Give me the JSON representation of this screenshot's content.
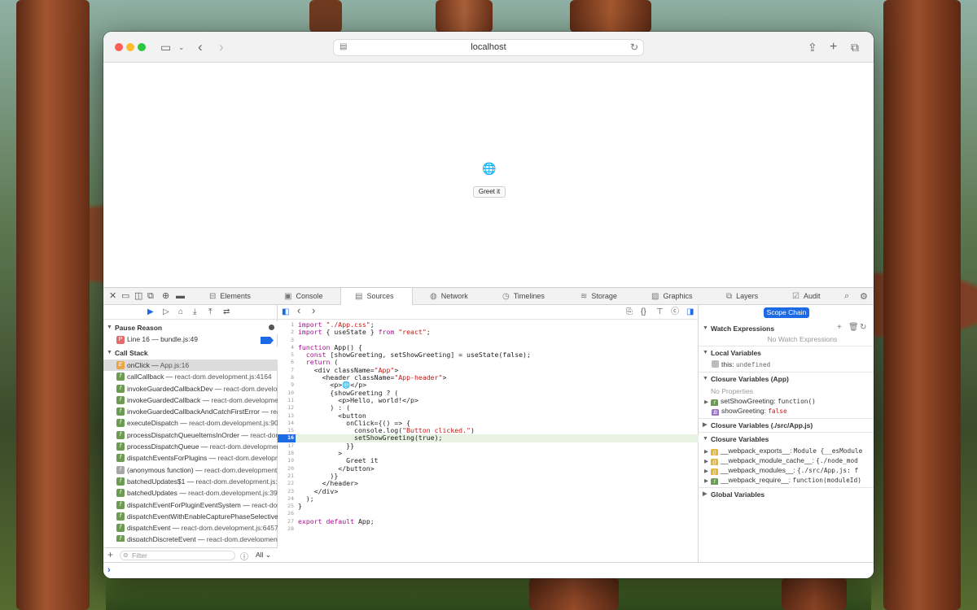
{
  "window": {
    "url": "localhost"
  },
  "page": {
    "greet_button": "Greet it"
  },
  "devtools": {
    "tabs": [
      {
        "label": "Elements",
        "icon": "elements-icon"
      },
      {
        "label": "Console",
        "icon": "console-icon"
      },
      {
        "label": "Sources",
        "icon": "sources-icon",
        "active": true
      },
      {
        "label": "Network",
        "icon": "network-icon"
      },
      {
        "label": "Timelines",
        "icon": "timelines-icon"
      },
      {
        "label": "Storage",
        "icon": "storage-icon"
      },
      {
        "label": "Graphics",
        "icon": "graphics-icon"
      },
      {
        "label": "Layers",
        "icon": "layers-icon"
      },
      {
        "label": "Audit",
        "icon": "audit-icon"
      }
    ],
    "pause_reason": {
      "header": "Pause Reason",
      "badge": "P",
      "text": "Line 16 — bundle.js:49"
    },
    "call_stack": {
      "header": "Call Stack",
      "frames": [
        {
          "fn": "onClick",
          "loc": "App.js:16",
          "badge": "E"
        },
        {
          "fn": "callCallback",
          "loc": "react-dom.development.js:4164",
          "badge": "f"
        },
        {
          "fn": "invokeGuardedCallbackDev",
          "loc": "react-dom.development.js",
          "badge": "f"
        },
        {
          "fn": "invokeGuardedCallback",
          "loc": "react-dom.development.js",
          "badge": "f"
        },
        {
          "fn": "invokeGuardedCallbackAndCatchFirstError",
          "loc": "react-dom.development.js",
          "badge": "f"
        },
        {
          "fn": "executeDispatch",
          "loc": "react-dom.development.js:9041",
          "badge": "f"
        },
        {
          "fn": "processDispatchQueueItemsInOrder",
          "loc": "react-dom.development.js",
          "badge": "f"
        },
        {
          "fn": "processDispatchQueue",
          "loc": "react-dom.development.js",
          "badge": "f"
        },
        {
          "fn": "dispatchEventsForPlugins",
          "loc": "react-dom.development.js",
          "badge": "f"
        },
        {
          "fn": "(anonymous function)",
          "loc": "react-dom.development.js",
          "badge": "f"
        },
        {
          "fn": "batchedUpdates$1",
          "loc": "react-dom.development.js:2",
          "badge": "f"
        },
        {
          "fn": "batchedUpdates",
          "loc": "react-dom.development.js:39",
          "badge": "f"
        },
        {
          "fn": "dispatchEventForPluginEventSystem",
          "loc": "react-dom.development.js",
          "badge": "f"
        },
        {
          "fn": "dispatchEventWithEnableCapturePhaseSelectiveHydration",
          "loc": "react-dom.development.js",
          "badge": "f"
        },
        {
          "fn": "dispatchEvent",
          "loc": "react-dom.development.js:6457",
          "badge": "f"
        },
        {
          "fn": "dispatchDiscreteEvent",
          "loc": "react-dom.development.js",
          "badge": "f"
        }
      ]
    },
    "filter": {
      "placeholder": "Filter",
      "scope": "All"
    },
    "code": {
      "current_line": 16,
      "lines": [
        "import \"./App.css\";",
        "import { useState } from \"react\";",
        "",
        "function App() {",
        "  const [showGreeting, setShowGreeting] = useState(false);",
        "  return (",
        "    <div className=\"App\">",
        "      <header className=\"App-header\">",
        "        <p>🌐</p>",
        "        {showGreeting ? (",
        "          <p>Hello, world!</p>",
        "        ) : (",
        "          <button",
        "            onClick={() => {",
        "              console.log(\"Button clicked.\")",
        "              setShowGreeting(true);",
        "            }}",
        "          >",
        "            Greet it",
        "          </button>",
        "        )}",
        "      </header>",
        "    </div>",
        "  );",
        "}",
        "",
        "export default App;",
        ""
      ]
    },
    "details": {
      "scope_chain_button": "Scope Chain",
      "watch": {
        "header": "Watch Expressions",
        "empty": "No Watch Expressions"
      },
      "local": {
        "header": "Local Variables",
        "vars": [
          {
            "name": "this",
            "value": "undefined"
          }
        ]
      },
      "closure_app": {
        "header": "Closure Variables (App)",
        "empty": "No Properties",
        "vars": [
          {
            "name": "setShowGreeting",
            "value": "function()",
            "badge": "f"
          },
          {
            "name": "showGreeting",
            "value": "false",
            "badge": "B"
          }
        ]
      },
      "closure_src": {
        "header": "Closure Variables (./src/App.js)"
      },
      "closure_webpack": {
        "header": "Closure Variables",
        "vars": [
          {
            "name": "__webpack_exports__",
            "value": "Module {__esModule",
            "badge": "{}"
          },
          {
            "name": "__webpack_module_cache__",
            "value": "{./node_mod",
            "badge": "{}"
          },
          {
            "name": "__webpack_modules__",
            "value": "{./src/App.js: f",
            "badge": "{}"
          },
          {
            "name": "__webpack_require__",
            "value": "function(moduleId)",
            "badge": "f"
          }
        ]
      },
      "global": {
        "header": "Global Variables"
      }
    }
  }
}
